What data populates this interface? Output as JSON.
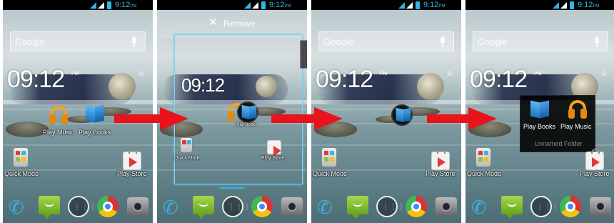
{
  "status": {
    "time": "9:12",
    "ampm": "PM"
  },
  "search": {
    "placeholder": "Google"
  },
  "clock": {
    "time": "09:12",
    "ampm": "PM"
  },
  "apps": {
    "play_music": "Play Music",
    "play_books": "Play Books",
    "quick_mode": "Quick Mode",
    "play_store": "Play Store"
  },
  "remove_zone": {
    "label": "Remove"
  },
  "folder": {
    "items": [
      "Play Books",
      "Play Music"
    ],
    "name_placeholder": "Unnamed Folder"
  },
  "colors": {
    "accent": "#33b5e5",
    "arrow": "#e8131b"
  }
}
